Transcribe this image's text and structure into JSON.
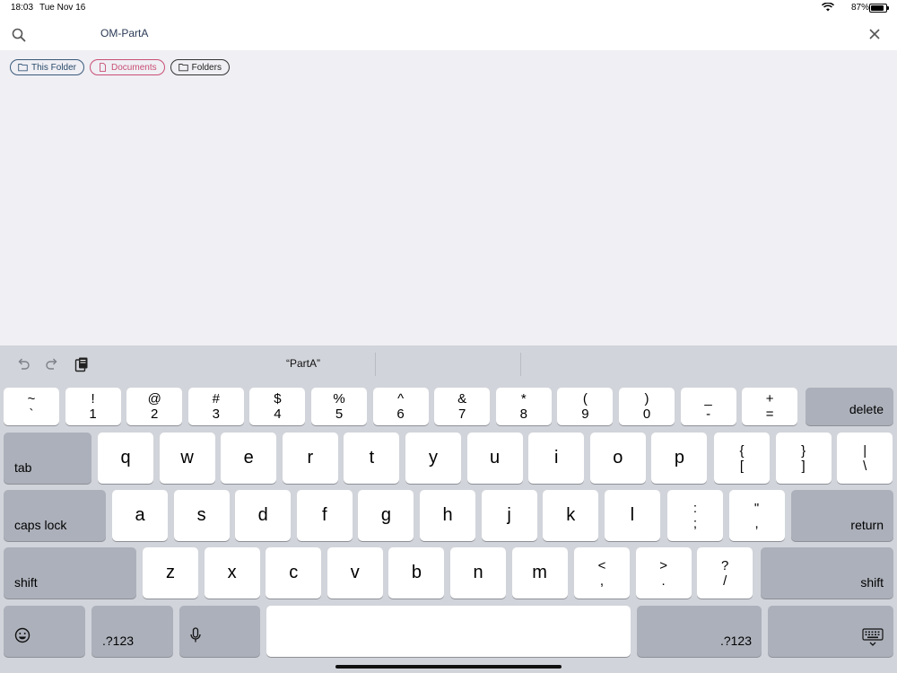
{
  "status": {
    "time": "18:03",
    "date": "Tue Nov 16",
    "battery": "87%",
    "battery_level": 0.87
  },
  "search": {
    "value": "OM-PartA",
    "placeholder": ""
  },
  "chips": [
    {
      "label": "This Folder",
      "icon": "folder-icon"
    },
    {
      "label": "Documents",
      "icon": "document-icon"
    },
    {
      "label": "Folders",
      "icon": "folder-icon"
    }
  ],
  "keyboard": {
    "suggestion": "“PartA”",
    "row1": [
      {
        "top": "~",
        "bottom": "`"
      },
      {
        "top": "!",
        "bottom": "1"
      },
      {
        "top": "@",
        "bottom": "2"
      },
      {
        "top": "#",
        "bottom": "3"
      },
      {
        "top": "$",
        "bottom": "4"
      },
      {
        "top": "%",
        "bottom": "5"
      },
      {
        "top": "^",
        "bottom": "6"
      },
      {
        "top": "&",
        "bottom": "7"
      },
      {
        "top": "*",
        "bottom": "8"
      },
      {
        "top": "(",
        "bottom": "9"
      },
      {
        "top": ")",
        "bottom": "0"
      },
      {
        "top": "_",
        "bottom": "-"
      },
      {
        "top": "+",
        "bottom": "="
      }
    ],
    "delete": "delete",
    "tab": "tab",
    "row2": [
      "q",
      "w",
      "e",
      "r",
      "t",
      "y",
      "u",
      "i",
      "o",
      "p"
    ],
    "row2_sym": [
      {
        "top": "{",
        "bottom": "["
      },
      {
        "top": "}",
        "bottom": "]"
      },
      {
        "top": "|",
        "bottom": "\\"
      }
    ],
    "caps": "caps lock",
    "row3": [
      "a",
      "s",
      "d",
      "f",
      "g",
      "h",
      "j",
      "k",
      "l"
    ],
    "row3_sym": [
      {
        "top": ":",
        "bottom": ";"
      },
      {
        "top": "\"",
        "bottom": ","
      }
    ],
    "return": "return",
    "shift": "shift",
    "row4": [
      "z",
      "x",
      "c",
      "v",
      "b",
      "n",
      "m"
    ],
    "row4_sym": [
      {
        "top": "<",
        "bottom": ","
      },
      {
        "top": ">",
        "bottom": "."
      },
      {
        "top": "?",
        "bottom": "/"
      }
    ],
    "num_label": ".?123",
    "icons": {
      "emoji": "emoji-icon",
      "mic": "microphone-icon",
      "dismiss": "keyboard-dismiss-icon"
    }
  }
}
